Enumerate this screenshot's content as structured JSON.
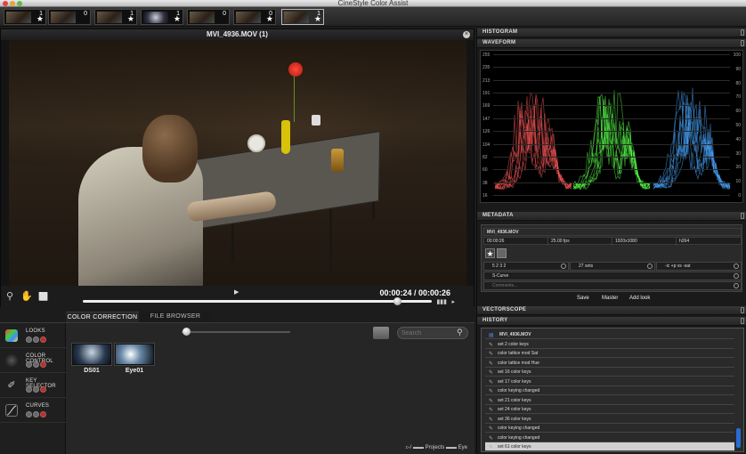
{
  "window": {
    "title": "CineStyle Color Assist"
  },
  "filmstrip": [
    {
      "count": "1",
      "starred": true
    },
    {
      "count": "0",
      "starred": false
    },
    {
      "count": "1",
      "starred": true
    },
    {
      "count": "1",
      "starred": true
    },
    {
      "count": "0",
      "starred": false
    },
    {
      "count": "0",
      "starred": true
    },
    {
      "count": "1",
      "starred": true
    }
  ],
  "viewer": {
    "clip_title": "MVI_4936.MOV (1)",
    "timecode": "00:00:24 / 00:00:26",
    "playhead_fraction": 0.9
  },
  "tabs": {
    "active": "COLOR CORRECTION",
    "inactive": "FILE BROWSER"
  },
  "sidebar": {
    "items": [
      {
        "label": "LOOKS"
      },
      {
        "label": "COLOR CONTROL"
      },
      {
        "label": "KEY SELECTOR"
      },
      {
        "label": "CURVES"
      }
    ]
  },
  "looks": [
    {
      "label": "DS01"
    },
    {
      "label": "Eye01"
    }
  ],
  "search": {
    "placeholder": "Search"
  },
  "breadcrumb": {
    "text": "▻/  ▬▬ Projects  ▬▬ Eye"
  },
  "panels": {
    "histogram": "HISTOGRAM",
    "waveform": "WAVEFORM",
    "metadata": "METADATA",
    "vectorscope": "VECTORSCOPE",
    "history": "HISTORY"
  },
  "waveform_scale": {
    "left": [
      "255",
      "235",
      "213",
      "191",
      "169",
      "147",
      "126",
      "104",
      "82",
      "60",
      "38",
      "16"
    ],
    "right": [
      "100",
      "90",
      "80",
      "70",
      "60",
      "50",
      "40",
      "30",
      "20",
      "10",
      "0"
    ]
  },
  "metadata": {
    "filename": "MVI_4936.MOV",
    "duration": "00:00:26",
    "fps": "25.00 fps",
    "resolution": "1920x1080",
    "codec": "h264",
    "field1": "5 2 3 2",
    "field2": "27 sets",
    "field3": "-ic +p vs -sat",
    "curve": "S-Curve",
    "comments_placeholder": "Comments..."
  },
  "meta_buttons": {
    "save": "Save",
    "master": "Master",
    "add_look": "Add look"
  },
  "history": [
    "MVI_4936.MOV",
    "set 2 color keys",
    "color lattice mod Sat",
    "color lattice mod Hue",
    "set 16 color keys",
    "set 17 color keys",
    "color keying changed",
    "set 21 color keys",
    "set 24 color keys",
    "set 36 color keys",
    "color keying changed",
    "color keying changed",
    "set 61 color keys"
  ],
  "colors": {
    "wave_red": "#ff5a5a",
    "wave_green": "#5aff4a",
    "wave_blue": "#4aa8ff",
    "accent_blue": "#2a6bd0"
  }
}
